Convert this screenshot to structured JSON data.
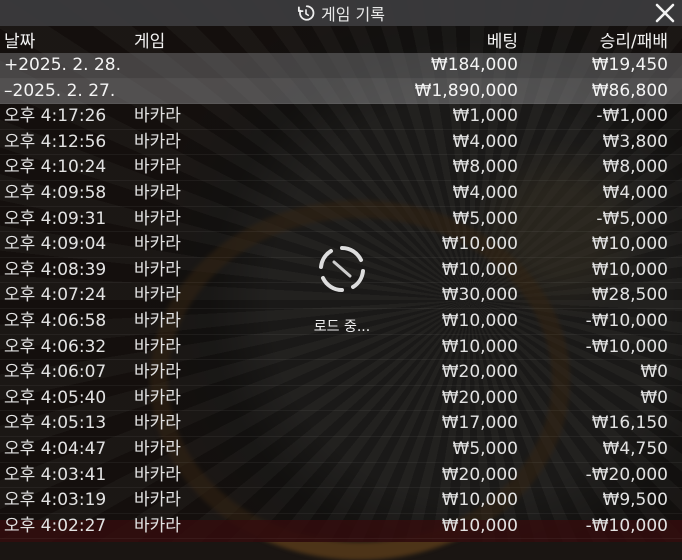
{
  "title": "게임 기록",
  "icons": {
    "history": "history-icon",
    "close": "close-icon",
    "spinner": "loading-spinner-icon"
  },
  "columns": {
    "date": "날짜",
    "game": "게임",
    "bet": "베팅",
    "win_loss": "승리/패배"
  },
  "loading_text": "로드 중...",
  "day_rows": [
    {
      "date": "+2025. 2. 28.",
      "bet": "₩184,000",
      "win_loss": "₩19,450"
    },
    {
      "date": "–2025. 2. 27.",
      "bet": "₩1,890,000",
      "win_loss": "₩86,800"
    }
  ],
  "rows": [
    {
      "time": "오후 4:17:26",
      "game": "바카라",
      "bet": "₩1,000",
      "win_loss": "-₩1,000"
    },
    {
      "time": "오후 4:12:56",
      "game": "바카라",
      "bet": "₩4,000",
      "win_loss": "₩3,800"
    },
    {
      "time": "오후 4:10:24",
      "game": "바카라",
      "bet": "₩8,000",
      "win_loss": "₩8,000"
    },
    {
      "time": "오후 4:09:58",
      "game": "바카라",
      "bet": "₩4,000",
      "win_loss": "₩4,000"
    },
    {
      "time": "오후 4:09:31",
      "game": "바카라",
      "bet": "₩5,000",
      "win_loss": "-₩5,000"
    },
    {
      "time": "오후 4:09:04",
      "game": "바카라",
      "bet": "₩10,000",
      "win_loss": "₩10,000"
    },
    {
      "time": "오후 4:08:39",
      "game": "바카라",
      "bet": "₩10,000",
      "win_loss": "₩10,000"
    },
    {
      "time": "오후 4:07:24",
      "game": "바카라",
      "bet": "₩30,000",
      "win_loss": "₩28,500"
    },
    {
      "time": "오후 4:06:58",
      "game": "바카라",
      "bet": "₩10,000",
      "win_loss": "-₩10,000"
    },
    {
      "time": "오후 4:06:32",
      "game": "바카라",
      "bet": "₩10,000",
      "win_loss": "-₩10,000"
    },
    {
      "time": "오후 4:06:07",
      "game": "바카라",
      "bet": "₩20,000",
      "win_loss": "₩0"
    },
    {
      "time": "오후 4:05:40",
      "game": "바카라",
      "bet": "₩20,000",
      "win_loss": "₩0"
    },
    {
      "time": "오후 4:05:13",
      "game": "바카라",
      "bet": "₩17,000",
      "win_loss": "₩16,150"
    },
    {
      "time": "오후 4:04:47",
      "game": "바카라",
      "bet": "₩5,000",
      "win_loss": "₩4,750"
    },
    {
      "time": "오후 4:03:41",
      "game": "바카라",
      "bet": "₩20,000",
      "win_loss": "-₩20,000"
    },
    {
      "time": "오후 4:03:19",
      "game": "바카라",
      "bet": "₩10,000",
      "win_loss": "₩9,500"
    },
    {
      "time": "오후 4:02:27",
      "game": "바카라",
      "bet": "₩10,000",
      "win_loss": "-₩10,000"
    }
  ]
}
